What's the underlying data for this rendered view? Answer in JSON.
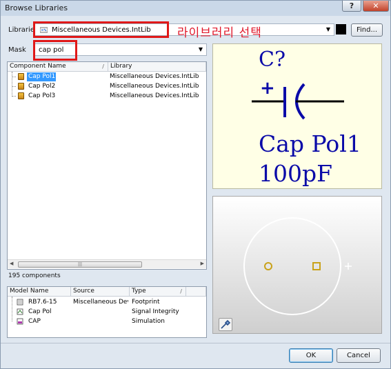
{
  "window": {
    "title": "Browse Libraries"
  },
  "titlebar": {
    "help_label": "?",
    "close_label": "✕"
  },
  "library": {
    "label": "Libraries",
    "selected": "Miscellaneous Devices.IntLib",
    "find_label": "Find...",
    "annotation": "라이브러리 선택"
  },
  "mask": {
    "label": "Mask",
    "value": "cap pol"
  },
  "components": {
    "headers": [
      "Component Name",
      "Library"
    ],
    "rows": [
      {
        "name": "Cap Pol1",
        "library": "Miscellaneous Devices.IntLib"
      },
      {
        "name": "Cap Pol2",
        "library": "Miscellaneous Devices.IntLib"
      },
      {
        "name": "Cap Pol3",
        "library": "Miscellaneous Devices.IntLib"
      }
    ],
    "selected_index": 0,
    "count_text": "195 components"
  },
  "models": {
    "headers": [
      "Model Name",
      "Source",
      "Type"
    ],
    "rows": [
      {
        "name": "RB7.6-15",
        "source": "Miscellaneous Dev",
        "type": "Footprint",
        "icon": "footprint-icon"
      },
      {
        "name": "Cap Pol",
        "source": "",
        "type": "Signal Integrity",
        "icon": "signal-integrity-icon"
      },
      {
        "name": "CAP",
        "source": "",
        "type": "Simulation",
        "icon": "simulation-icon"
      }
    ]
  },
  "schematic_preview": {
    "designator": "C?",
    "polarity": "+",
    "component": "Cap Pol1",
    "value": "100pF"
  },
  "buttons": {
    "ok": "OK",
    "cancel": "Cancel"
  },
  "colors": {
    "annotation_red": "#e01818",
    "selection": "#3399ff",
    "schematic_text": "#0a0aa8",
    "pad_gold": "#c9a21a"
  }
}
